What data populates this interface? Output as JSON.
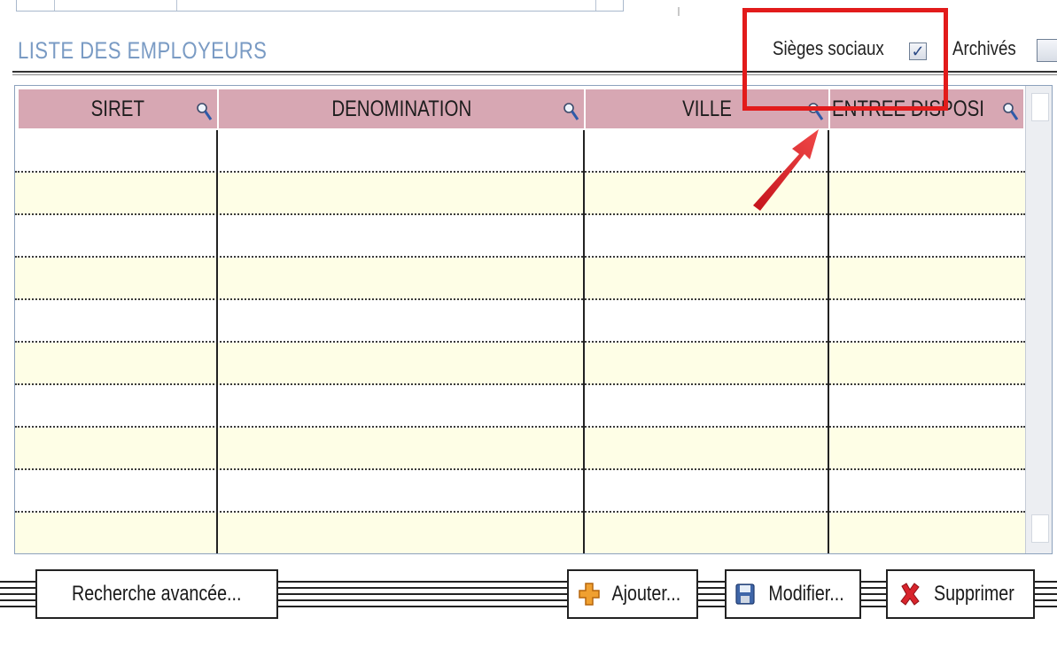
{
  "section": {
    "title": "LISTE DES EMPLOYEURS"
  },
  "filters": {
    "sieges_label": "Sièges sociaux",
    "sieges_checked": true,
    "archives_label": "Archivés",
    "archives_checked": false
  },
  "table": {
    "columns": [
      "SIRET",
      "DENOMINATION",
      "VILLE",
      "ENTREE DISPOSI"
    ],
    "rows": [
      [
        "",
        "",
        "",
        ""
      ],
      [
        "",
        "",
        "",
        ""
      ],
      [
        "",
        "",
        "",
        ""
      ],
      [
        "",
        "",
        "",
        ""
      ],
      [
        "",
        "",
        "",
        ""
      ],
      [
        "",
        "",
        "",
        ""
      ],
      [
        "",
        "",
        "",
        ""
      ],
      [
        "",
        "",
        "",
        ""
      ],
      [
        "",
        "",
        "",
        ""
      ],
      [
        "",
        "",
        "",
        ""
      ]
    ]
  },
  "toolbar": {
    "advanced_search_label": "Recherche avancée...",
    "add_label": "Ajouter...",
    "edit_label": "Modifier...",
    "delete_label": "Supprimer"
  },
  "colors": {
    "header_bg": "#d7a7b3",
    "row_alt_bg": "#fefee6",
    "title_color": "#7a9bc4",
    "highlight": "#e21b1b"
  },
  "icons": [
    "magnifier-icon",
    "add-icon",
    "save-icon",
    "delete-icon",
    "checkbox-checked-icon"
  ]
}
